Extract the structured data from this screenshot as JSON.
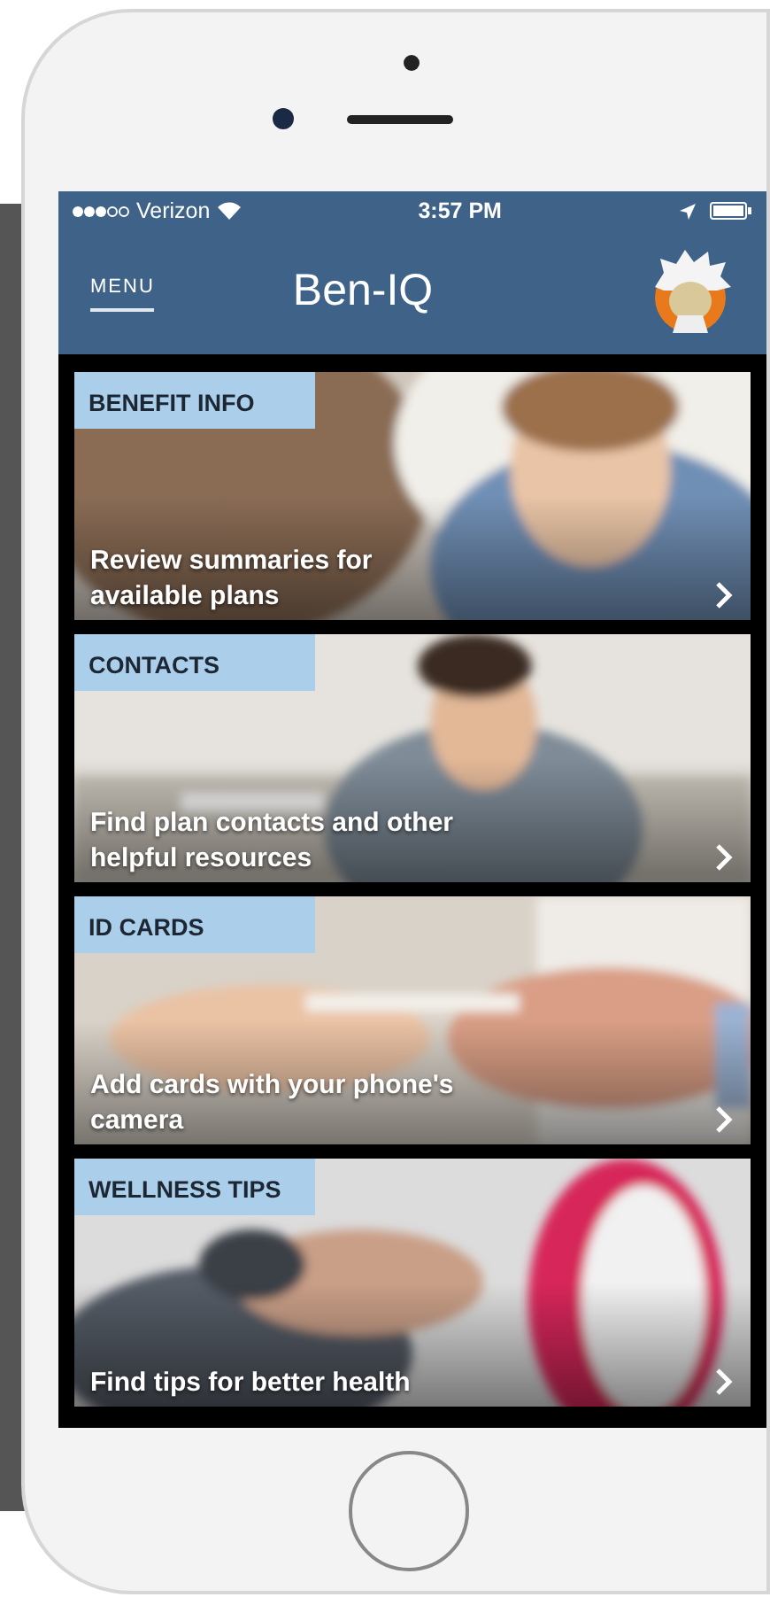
{
  "status_bar": {
    "carrier": "Verizon",
    "time": "3:57 PM"
  },
  "header": {
    "menu": "MENU",
    "title": "Ben-IQ"
  },
  "tiles": [
    {
      "label": "BENEFIT INFO",
      "text": "Review summaries for available plans"
    },
    {
      "label": "CONTACTS",
      "text": "Find plan contacts and other helpful resources"
    },
    {
      "label": "ID CARDS",
      "text": "Add cards with your phone's camera"
    },
    {
      "label": "WELLNESS TIPS",
      "text": "Find tips for better health"
    }
  ]
}
